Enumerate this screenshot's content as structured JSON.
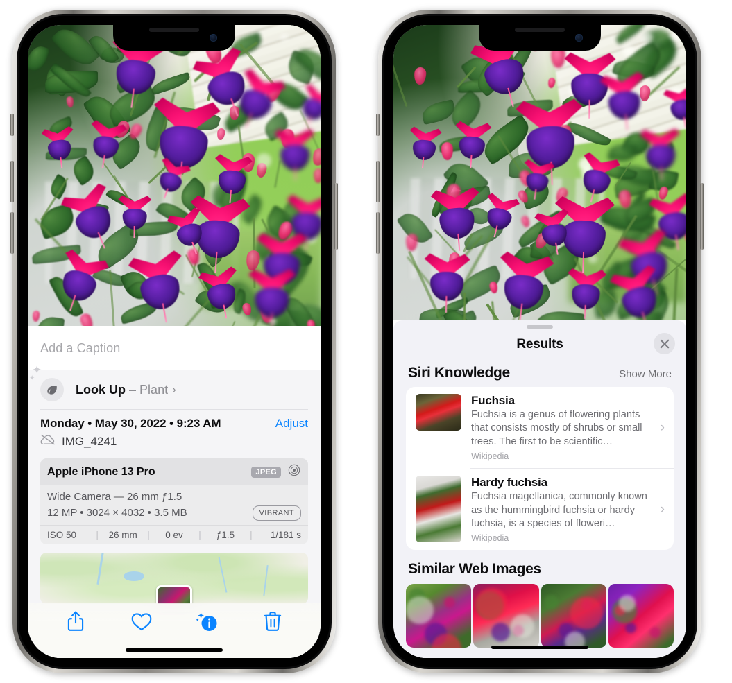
{
  "left_phone": {
    "name": "iphone-photos-info-view",
    "caption": {
      "placeholder": "Add a Caption",
      "value": ""
    },
    "lookup": {
      "label": "Look Up",
      "dash": "–",
      "subject": "Plant",
      "chevron": "›",
      "icon": "leaf-icon",
      "sparkle": "✦"
    },
    "meta": {
      "date": "Monday • May 30, 2022 • 9:23 AM",
      "adjust_label": "Adjust",
      "filename": "IMG_4241",
      "cloud_icon": "cloud-slash-icon"
    },
    "exif": {
      "device": "Apple iPhone 13 Pro",
      "format_badge": "JPEG",
      "lens_icon": "aperture-icon",
      "lens_line": "Wide Camera — 26 mm ƒ1.5",
      "size_line": "12 MP • 3024 × 4032 • 3.5 MB",
      "style_badge": "VIBRANT",
      "settings": [
        "ISO 50",
        "26 mm",
        "0 ev",
        "ƒ1.5",
        "1/181 s"
      ],
      "separator": "|"
    },
    "map": {
      "name": "location-map-thumbnail"
    },
    "toolbar": [
      {
        "name": "share-button",
        "icon": "share-icon",
        "label": "Share"
      },
      {
        "name": "favorite-button",
        "icon": "heart-icon",
        "label": "Favorite"
      },
      {
        "name": "info-button",
        "icon": "info-sparkle-icon",
        "label": "Info",
        "active": true
      },
      {
        "name": "delete-button",
        "icon": "trash-icon",
        "label": "Delete"
      }
    ]
  },
  "right_phone": {
    "name": "iphone-visual-lookup-results",
    "badge": {
      "icon": "leaf-icon",
      "name": "visual-lookup-badge"
    },
    "sheet": {
      "title": "Results",
      "close_icon": "close-icon",
      "sections": [
        {
          "title": "Siri Knowledge",
          "action": "Show More",
          "items": [
            {
              "title": "Fuchsia",
              "description": "Fuchsia is a genus of flowering plants that consists mostly of shrubs or small trees. The first to be scientific…",
              "source": "Wikipedia",
              "chevron": "›"
            },
            {
              "title": "Hardy fuchsia",
              "description": "Fuchsia magellanica, commonly known as the hummingbird fuchsia or hardy fuchsia, is a species of floweri…",
              "source": "Wikipedia",
              "chevron": "›"
            }
          ]
        },
        {
          "title": "Similar Web Images",
          "tiles": [
            {
              "name": "similar-image-1"
            },
            {
              "name": "similar-image-2"
            },
            {
              "name": "similar-image-3"
            },
            {
              "name": "similar-image-4"
            }
          ]
        }
      ]
    }
  },
  "colors": {
    "accent_blue": "#0a84ff",
    "sheet_bg": "#f2f2f7",
    "card_bg": "#ffffff",
    "secondary_text": "#8e8e93",
    "flower_pink": "#e8166f",
    "flower_purple": "#551ea0"
  }
}
